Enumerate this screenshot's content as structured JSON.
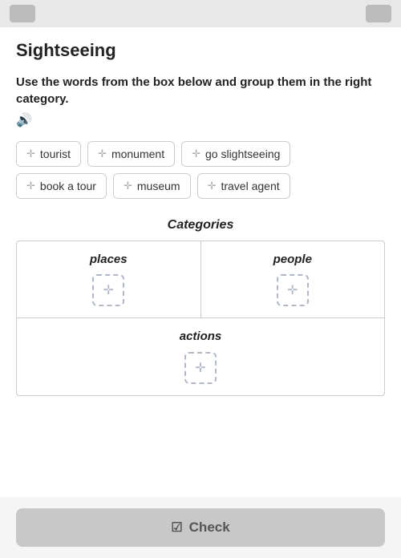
{
  "page": {
    "title": "Sightseeing",
    "instruction_text": "Use the words from the box below and group them in the right category.",
    "audio_icon": "🔊"
  },
  "word_bank": {
    "words": [
      {
        "id": "tourist",
        "label": "tourist"
      },
      {
        "id": "monument",
        "label": "monument"
      },
      {
        "id": "go_sightseeing",
        "label": "go slightseeing"
      },
      {
        "id": "book_a_tour",
        "label": "book a tour"
      },
      {
        "id": "museum",
        "label": "museum"
      },
      {
        "id": "travel_agent",
        "label": "travel agent"
      }
    ]
  },
  "categories_section": {
    "title": "Categories",
    "top_categories": [
      {
        "id": "places",
        "label": "places"
      },
      {
        "id": "people",
        "label": "people"
      }
    ],
    "bottom_category": {
      "id": "actions",
      "label": "actions"
    }
  },
  "toolbar": {
    "check_label": "Check"
  },
  "icons": {
    "drag": "✛",
    "drop_zone": "✛",
    "audio": "🔊",
    "check": "☑"
  }
}
